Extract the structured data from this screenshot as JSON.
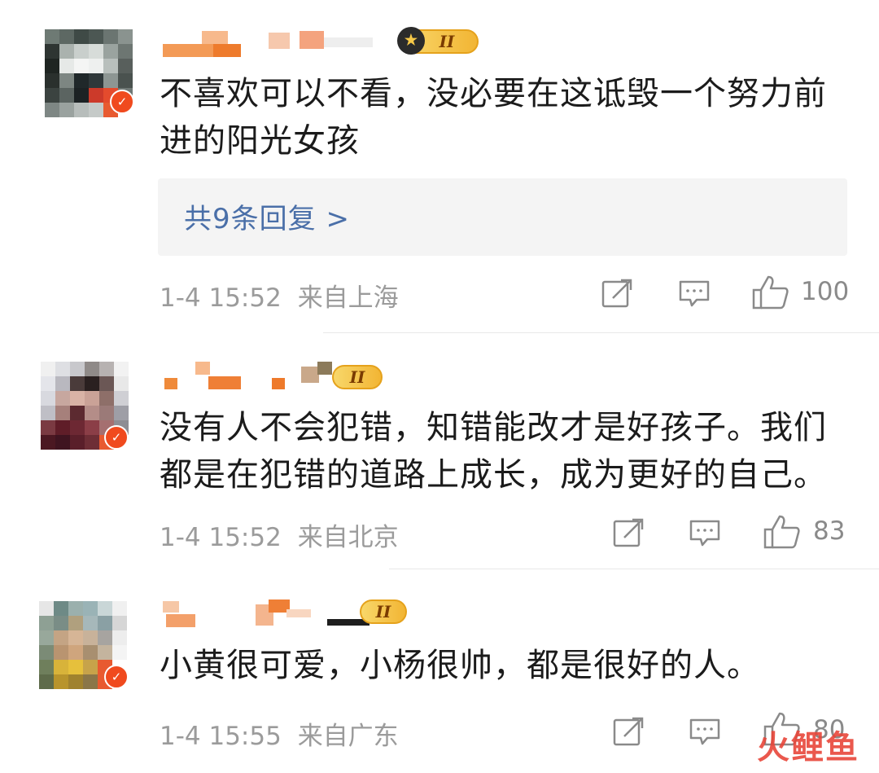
{
  "comments": [
    {
      "text": "不喜欢可以不看，没必要在这诋毁一个努力前进的阳光女孩",
      "level": "II",
      "time": "1-4 15:52",
      "location": "来自上海",
      "likes": "100",
      "replies_label": "共9条回复 >"
    },
    {
      "text": "没有人不会犯错，知错能改才是好孩子。我们都是在犯错的道路上成长，成为更好的自己。",
      "level": "II",
      "time": "1-4 15:52",
      "location": "来自北京",
      "likes": "83"
    },
    {
      "text": "小黄很可爱，小杨很帅，都是很好的人。",
      "level": "II",
      "time": "1-4 15:55",
      "location": "来自广东",
      "likes": "80"
    }
  ],
  "icons": {
    "share": "share-icon",
    "comment": "comment-icon",
    "like": "like-icon",
    "verified": "verified-badge-icon",
    "crown": "crown-icon"
  },
  "watermark": "火鲤鱼",
  "colors": {
    "reply_link": "#4a6fa8",
    "meta_gray": "#9b9b9b",
    "reply_bg": "#f4f4f4",
    "level_gold": "#f2b534",
    "verified_red": "#f04a1e"
  }
}
